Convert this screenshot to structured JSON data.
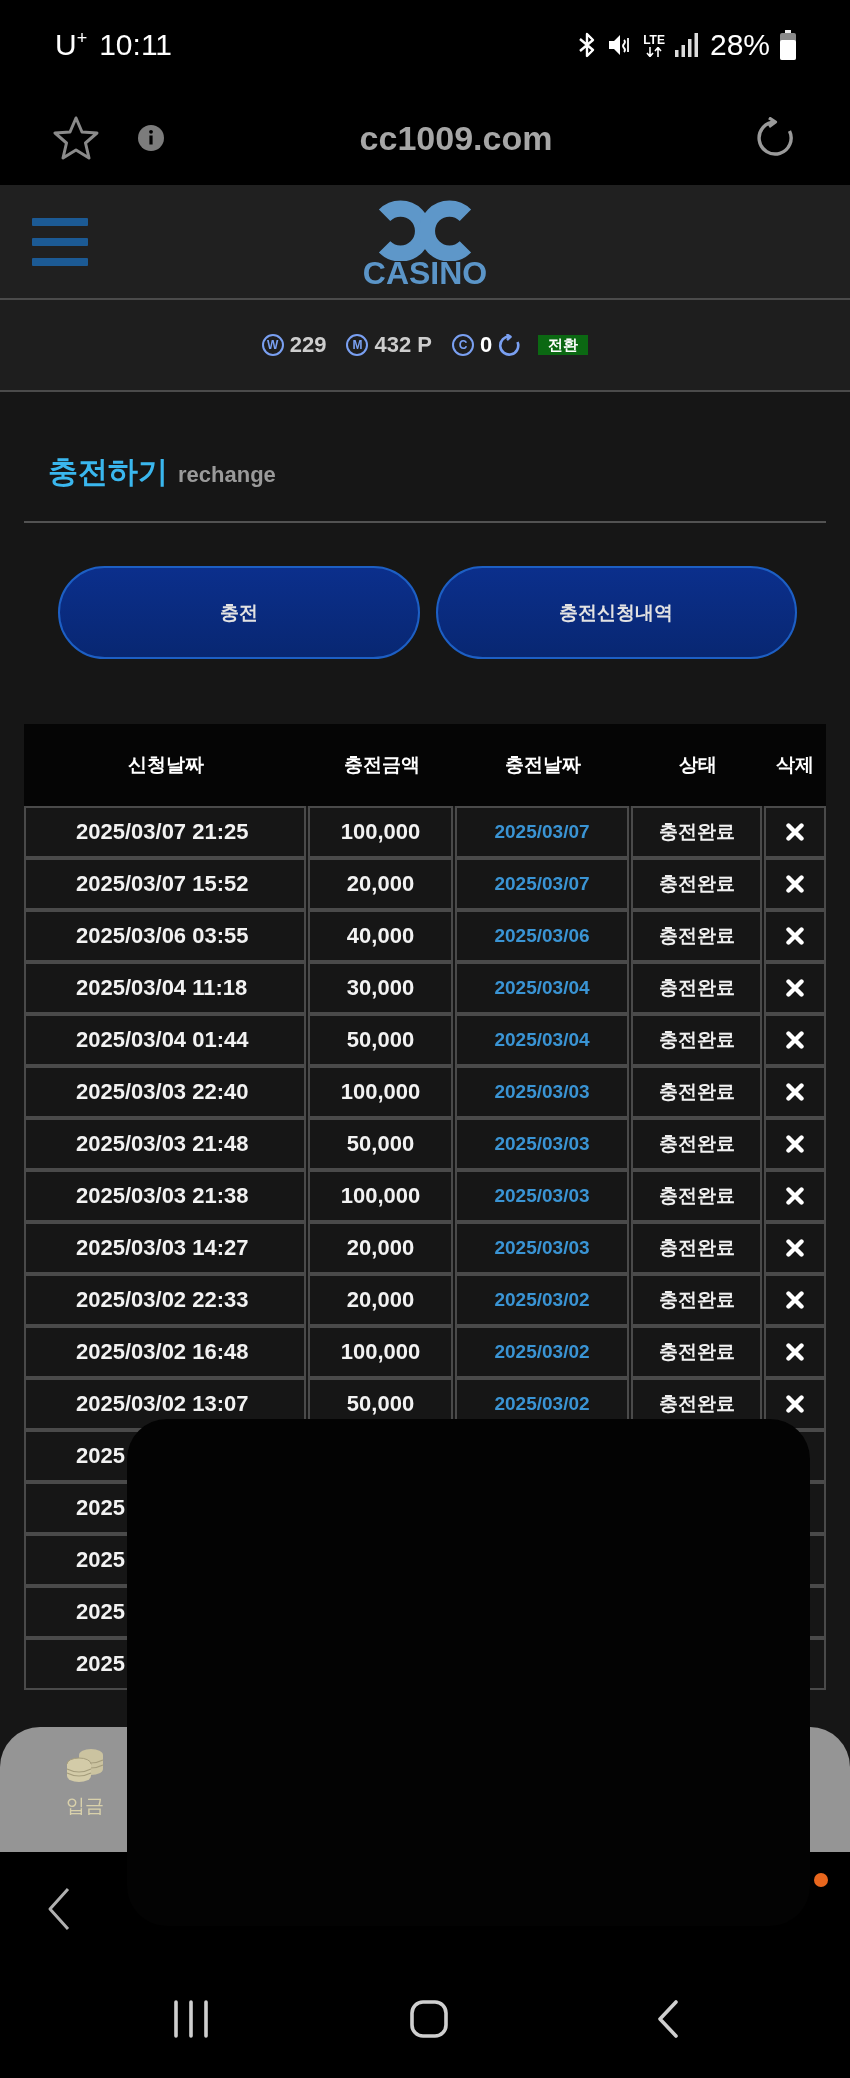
{
  "status_bar": {
    "carrier": "U$^{+}$",
    "time": "10:11",
    "network": "LTE",
    "battery": "28%"
  },
  "browser_bar": {
    "url": "cc1009.com"
  },
  "site_header": {
    "logo_text": "CASINO"
  },
  "balance_bar": {
    "items": [
      {
        "kind": "amount",
        "symbol": "W",
        "value": "229"
      },
      {
        "kind": "amount",
        "symbol": "M",
        "value": "432 P"
      },
      {
        "kind": "refreshable",
        "symbol": "C",
        "value": "0"
      }
    ],
    "convert_button": "전환"
  },
  "page_title": {
    "title": "충전하기",
    "subtitle": "rechange"
  },
  "action_buttons": [
    "충전",
    "충전신청내역"
  ],
  "table": {
    "columns": [
      "신청날짜",
      "충전금액",
      "충전날짜",
      "상태",
      "삭제"
    ],
    "rows": [
      {
        "requested_at": "2025/03/07 21:25",
        "amount": "100,000",
        "charged_on": "2025/03/07",
        "status": "충전완료"
      },
      {
        "requested_at": "2025/03/07 15:52",
        "amount": "20,000",
        "charged_on": "2025/03/07",
        "status": "충전완료"
      },
      {
        "requested_at": "2025/03/06 03:55",
        "amount": "40,000",
        "charged_on": "2025/03/06",
        "status": "충전완료"
      },
      {
        "requested_at": "2025/03/04 11:18",
        "amount": "30,000",
        "charged_on": "2025/03/04",
        "status": "충전완료"
      },
      {
        "requested_at": "2025/03/04 01:44",
        "amount": "50,000",
        "charged_on": "2025/03/04",
        "status": "충전완료"
      },
      {
        "requested_at": "2025/03/03 22:40",
        "amount": "100,000",
        "charged_on": "2025/03/03",
        "status": "충전완료"
      },
      {
        "requested_at": "2025/03/03 21:48",
        "amount": "50,000",
        "charged_on": "2025/03/03",
        "status": "충전완료"
      },
      {
        "requested_at": "2025/03/03 21:38",
        "amount": "100,000",
        "charged_on": "2025/03/03",
        "status": "충전완료"
      },
      {
        "requested_at": "2025/03/03 14:27",
        "amount": "20,000",
        "charged_on": "2025/03/03",
        "status": "충전완료"
      },
      {
        "requested_at": "2025/03/02 22:33",
        "amount": "20,000",
        "charged_on": "2025/03/02",
        "status": "충전완료"
      },
      {
        "requested_at": "2025/03/02 16:48",
        "amount": "100,000",
        "charged_on": "2025/03/02",
        "status": "충전완료"
      },
      {
        "requested_at": "2025/03/02 13:07",
        "amount": "50,000",
        "charged_on": "2025/03/02",
        "status": "충전완료"
      }
    ],
    "covered_rows": [
      {
        "requested_at": "2025"
      },
      {
        "requested_at": "2025"
      },
      {
        "requested_at": "2025"
      },
      {
        "requested_at": "2025"
      },
      {
        "requested_at": "2025"
      }
    ]
  },
  "bottom_nav": {
    "items": [
      {
        "label": "입금"
      }
    ]
  }
}
